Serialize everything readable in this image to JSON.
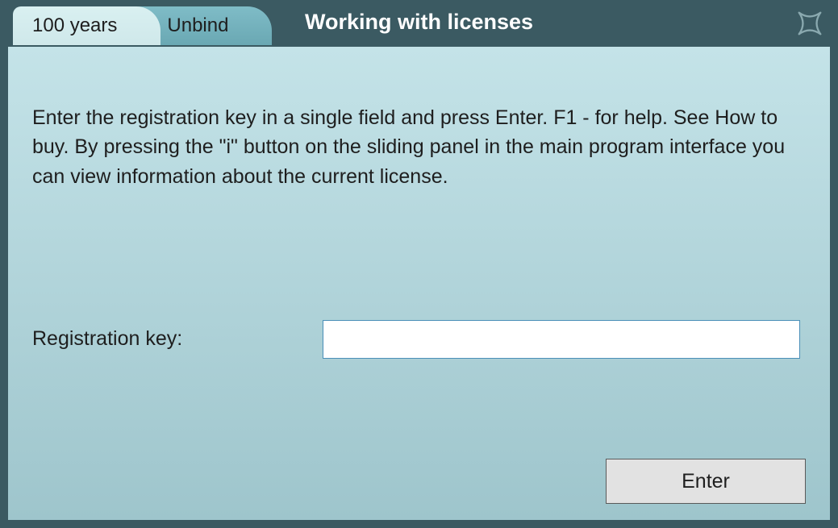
{
  "header": {
    "title": "Working with licenses",
    "tabs": [
      {
        "label": "100 years",
        "active": true
      },
      {
        "label": "Unbind",
        "active": false
      }
    ],
    "close_icon": "close-icon"
  },
  "content": {
    "instructions": "Enter the registration key in a single field and press Enter. F1 - for help. See How to buy. By pressing the \"i\" button on the sliding panel in the main program interface you can view information about the current license.",
    "form": {
      "label": "Registration key:",
      "value": ""
    },
    "buttons": {
      "enter": "Enter"
    }
  }
}
